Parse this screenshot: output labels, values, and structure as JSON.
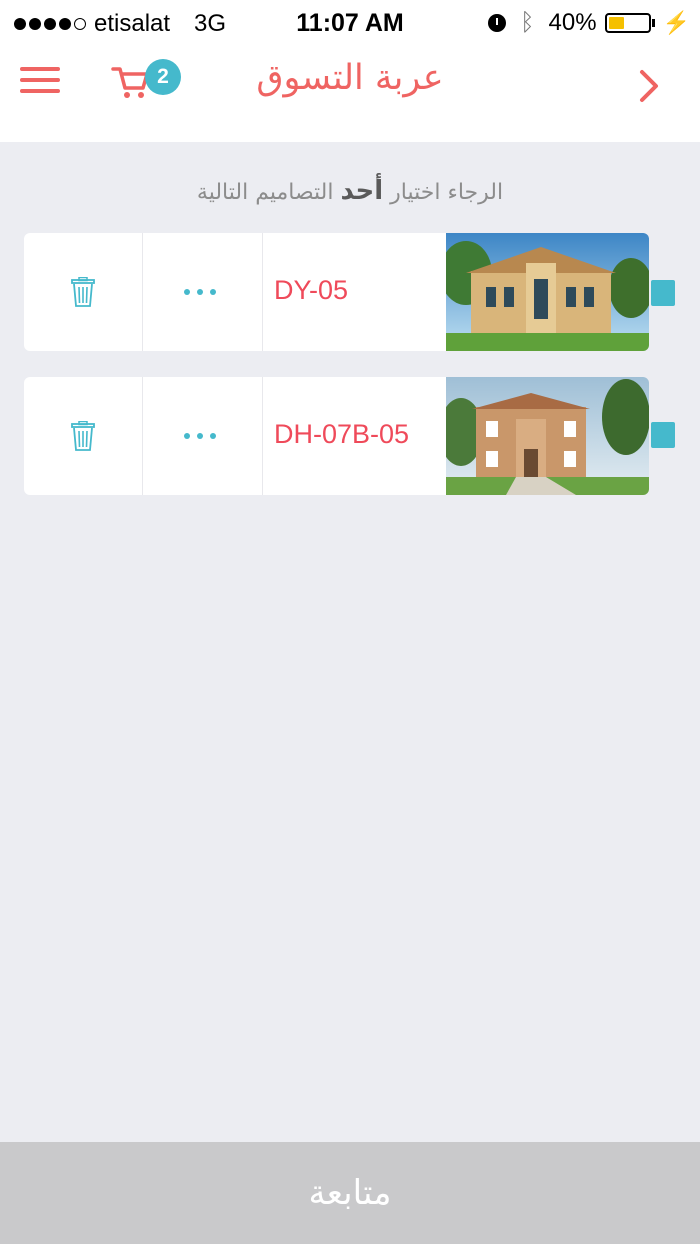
{
  "status_bar": {
    "carrier": "etisalat",
    "network": "3G",
    "time": "11:07 AM",
    "battery": "40%",
    "battery_fill": 0.4
  },
  "nav": {
    "title": "عربة التسوق",
    "cart_count": "2"
  },
  "instruction": {
    "part1": "الرجاء اختيار",
    "emphasis": "أحد",
    "part2": "التصاميم التالية"
  },
  "cart_items": [
    {
      "code": "DY-05"
    },
    {
      "code": "DH-07B-05"
    }
  ],
  "footer": {
    "continue_label": "متابعة"
  },
  "colors": {
    "accent": "#ef6462",
    "teal": "#45b9cc",
    "code_red": "#ef4a5a"
  }
}
